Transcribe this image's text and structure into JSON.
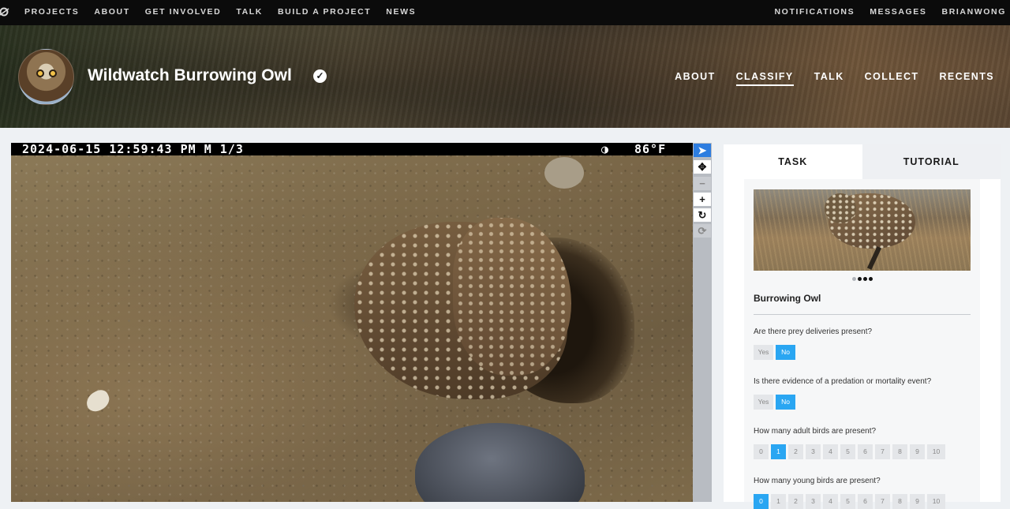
{
  "topnav": {
    "left": [
      "PROJECTS",
      "ABOUT",
      "GET INVOLVED",
      "TALK",
      "BUILD A PROJECT",
      "NEWS"
    ],
    "right": [
      "NOTIFICATIONS",
      "MESSAGES",
      "BRIANWONG"
    ]
  },
  "project": {
    "title": "Wildwatch Burrowing Owl",
    "nav": [
      "ABOUT",
      "CLASSIFY",
      "TALK",
      "COLLECT",
      "RECENTS"
    ],
    "active_nav": "CLASSIFY"
  },
  "subject": {
    "stamp_left": "2024-06-15 12:59:43 PM   M 1/3",
    "stamp_moon": "◑",
    "stamp_temp": "86°F"
  },
  "tools": {
    "pointer": "➤",
    "move": "✥",
    "zoom_out": "−",
    "zoom_in": "+",
    "rotate": "↻",
    "reset": "⟳"
  },
  "panel": {
    "tabs": [
      "TASK",
      "TUTORIAL"
    ],
    "species": "Burrowing Owl",
    "questions": [
      {
        "text": "Are there prey deliveries present?",
        "options": [
          "Yes",
          "No"
        ],
        "selected": "No"
      },
      {
        "text": "Is there evidence of a predation or mortality event?",
        "options": [
          "Yes",
          "No"
        ],
        "selected": "No"
      },
      {
        "text": "How many adult birds are present?",
        "options": [
          "0",
          "1",
          "2",
          "3",
          "4",
          "5",
          "6",
          "7",
          "8",
          "9",
          "10"
        ],
        "selected": "1"
      },
      {
        "text": "How many young birds are present?",
        "options": [
          "0",
          "1",
          "2",
          "3",
          "4",
          "5",
          "6",
          "7",
          "8",
          "9",
          "10"
        ],
        "selected": "0"
      }
    ]
  },
  "colors": {
    "accent": "#2aa6f2",
    "tool_active": "#2d7de0",
    "topbar": "#0b0b0b"
  }
}
